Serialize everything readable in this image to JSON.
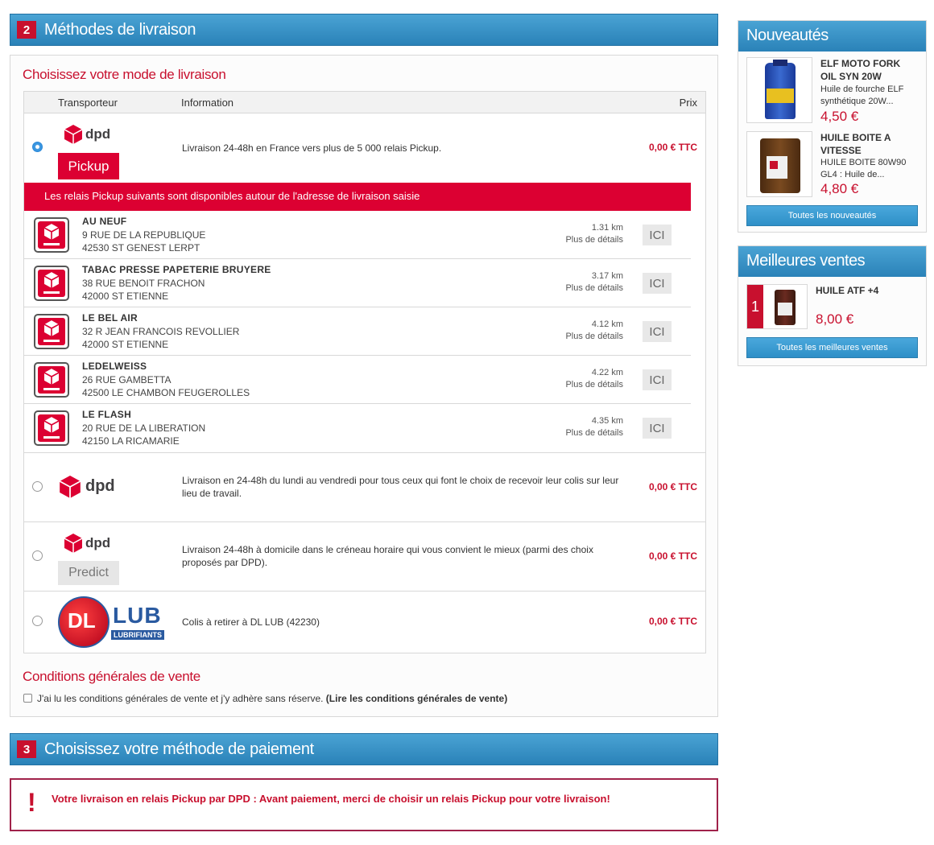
{
  "step2": {
    "number": "2",
    "title": "Méthodes de livraison"
  },
  "delivery": {
    "heading": "Choisissez votre mode de livraison",
    "columns": {
      "carrier": "Transporteur",
      "information": "Information",
      "price": "Prix"
    },
    "options": [
      {
        "logo_word": "dpd",
        "logo_sub": "Pickup",
        "info": "Livraison 24-48h en France vers plus de 5 000 relais Pickup.",
        "price": "0,00 € TTC",
        "selected": true
      },
      {
        "logo_word": "dpd",
        "logo_sub": "",
        "info": "Livraison en 24-48h du lundi au vendredi pour tous ceux qui font le choix de recevoir leur colis sur leur lieu de travail.",
        "price": "0,00 € TTC",
        "selected": false
      },
      {
        "logo_word": "dpd",
        "logo_sub": "Predict",
        "info": "Livraison 24-48h à domicile dans le créneau horaire qui vous convient le mieux (parmi des choix proposés par DPD).",
        "price": "0,00 € TTC",
        "selected": false
      },
      {
        "logo_word": "DL LUB",
        "logo_sub": "LUBRIFIANTS",
        "info": "Colis à retirer à DL LUB (42230)",
        "price": "0,00 € TTC",
        "selected": false
      }
    ],
    "pickup_banner": "Les relais Pickup suivants sont disponibles autour de l'adresse de livraison saisie",
    "relays": [
      {
        "name": "AU NEUF",
        "street": "9 RUE DE LA REPUBLIQUE",
        "city": "42530 ST GENEST LERPT",
        "distance": "1.31 km",
        "details": "Plus de détails",
        "button": "ICI"
      },
      {
        "name": "TABAC PRESSE PAPETERIE BRUYERE",
        "street": "38 RUE BENOIT FRACHON",
        "city": "42000 ST ETIENNE",
        "distance": "3.17 km",
        "details": "Plus de détails",
        "button": "ICI"
      },
      {
        "name": "LE BEL AIR",
        "street": "32 R JEAN FRANCOIS REVOLLIER",
        "city": "42000 ST ETIENNE",
        "distance": "4.12 km",
        "details": "Plus de détails",
        "button": "ICI"
      },
      {
        "name": "LEDELWEISS",
        "street": "26 RUE GAMBETTA",
        "city": "42500 LE CHAMBON FEUGEROLLES",
        "distance": "4.22 km",
        "details": "Plus de détails",
        "button": "ICI"
      },
      {
        "name": "LE FLASH",
        "street": "20 RUE DE LA LIBERATION",
        "city": "42150 LA RICAMARIE",
        "distance": "4.35 km",
        "details": "Plus de détails",
        "button": "ICI"
      }
    ]
  },
  "cgv": {
    "heading": "Conditions générales de vente",
    "text": "J'ai lu les conditions générales de vente et j'y adhère sans réserve.",
    "link": "(Lire les conditions générales de vente)",
    "checked": false
  },
  "step3": {
    "number": "3",
    "title": "Choisissez votre méthode de paiement"
  },
  "alert": {
    "icon": "!",
    "message": "Votre livraison en relais Pickup par DPD : Avant paiement, merci de choisir un relais Pickup pour votre livraison!"
  },
  "sidebar": {
    "new": {
      "title": "Nouveautés",
      "products": [
        {
          "name": "ELF MOTO FORK OIL SYN 20W",
          "desc": "Huile de fourche ELF synthétique 20W...",
          "price": "4,50 €"
        },
        {
          "name": "HUILE BOITE A VITESSE",
          "desc": "HUILE BOITE 80W90 GL4 : Huile de...",
          "price": "4,80 €"
        }
      ],
      "button": "Toutes les nouveautés"
    },
    "best": {
      "title": "Meilleures ventes",
      "products": [
        {
          "rank": "1",
          "name": "HUILE ATF +4",
          "price": "8,00 €"
        }
      ],
      "button": "Toutes les meilleures ventes"
    }
  },
  "colors": {
    "accent_red": "#c8102e",
    "dpd_red": "#dc0032",
    "header_blue": "#2a82b8"
  }
}
